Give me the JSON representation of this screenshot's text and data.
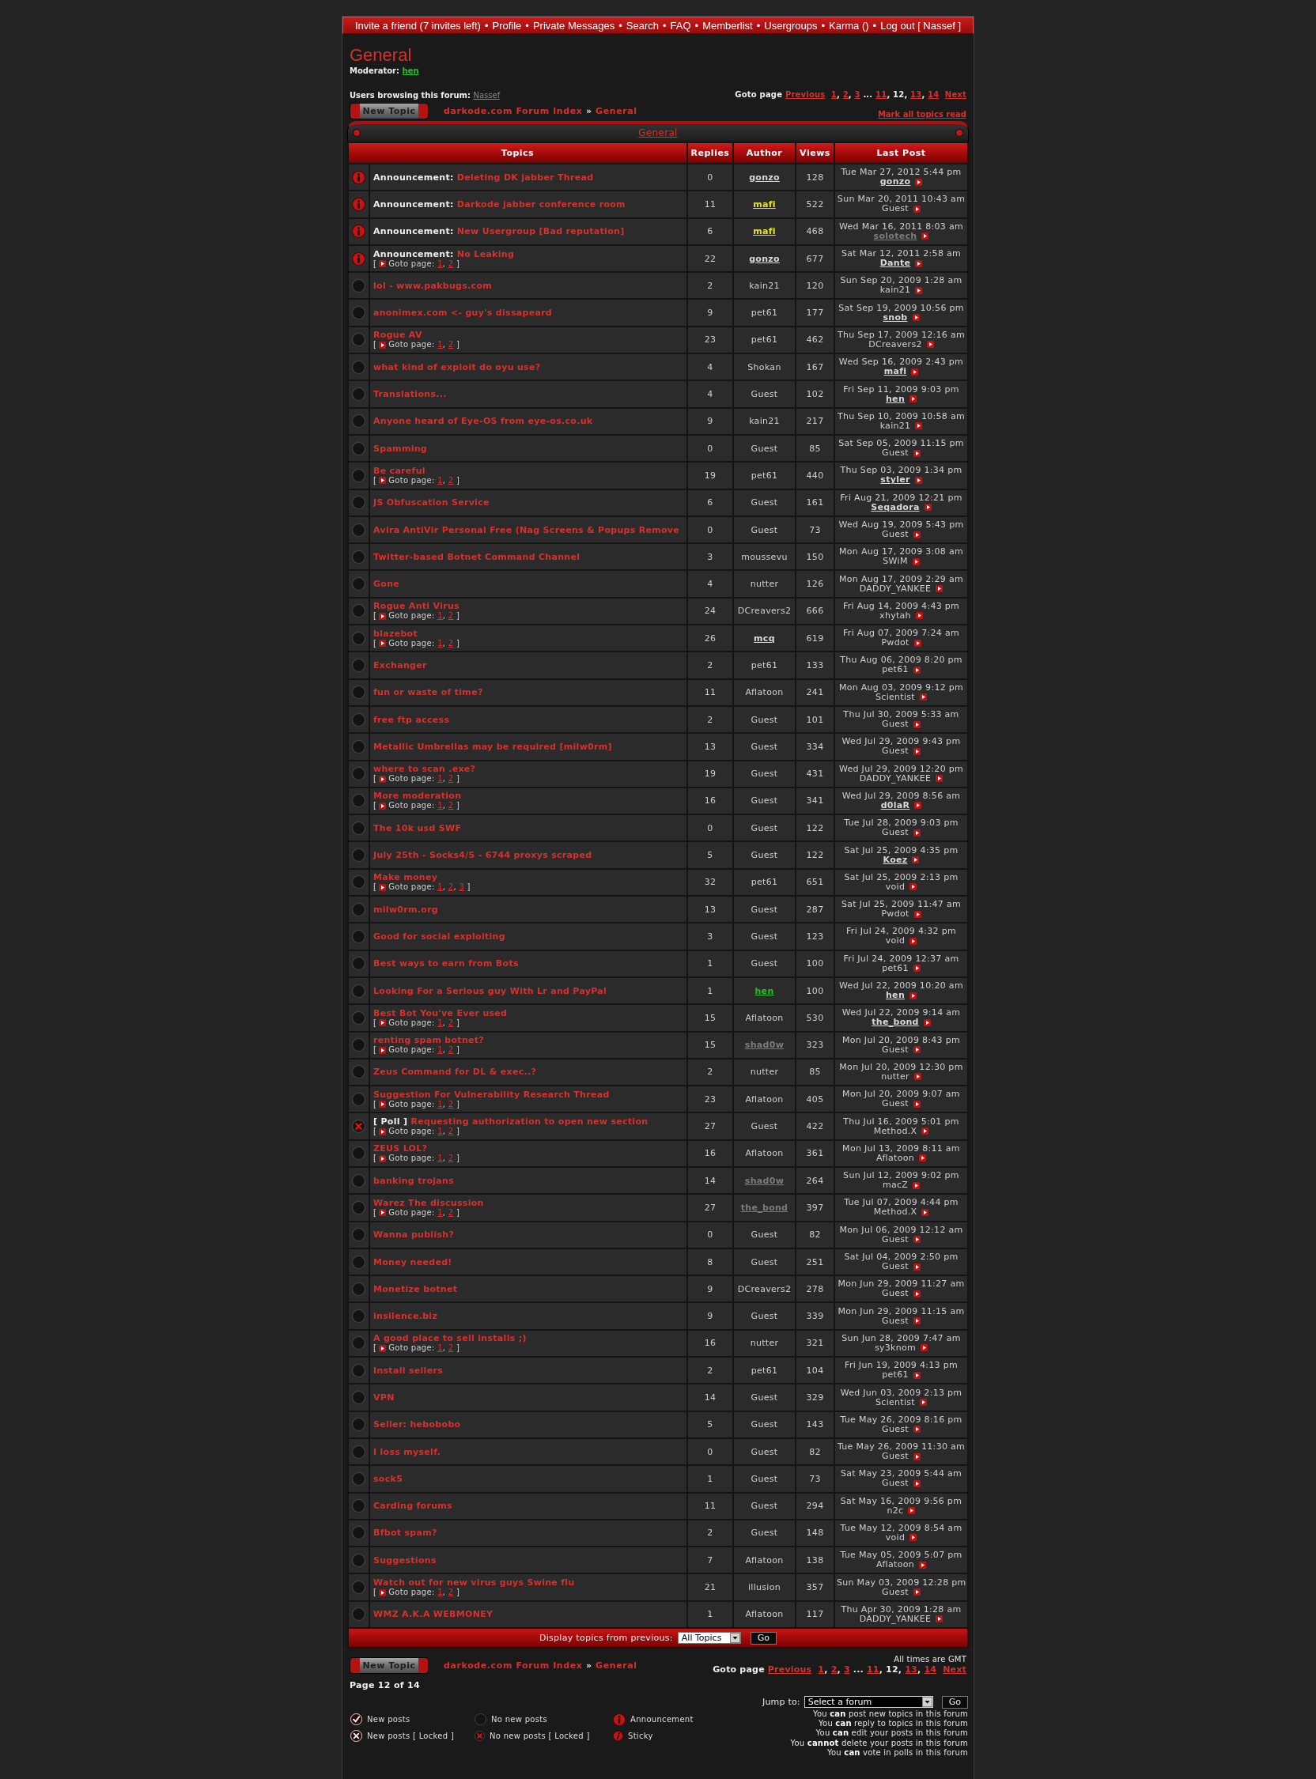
{
  "nav": {
    "links": [
      "Invite a friend (7 invites left)",
      "Profile",
      "Private Messages",
      "Search",
      "FAQ",
      "Memberlist",
      "Usergroups",
      "Karma ()",
      "Log out [ Nassef ]"
    ],
    "separator": "•"
  },
  "forum": {
    "title": "General",
    "moderator_label": "Moderator:",
    "moderator": "hen"
  },
  "browsing": {
    "label": "Users browsing this forum:",
    "user": "Nassef"
  },
  "top_pagination": {
    "label": "Goto page",
    "previous": "Previous",
    "pages": [
      {
        "kind": "page",
        "label": "1",
        "selected": false,
        "sep": ","
      },
      {
        "kind": "page",
        "label": "2",
        "selected": false,
        "sep": ","
      },
      {
        "kind": "page",
        "label": "3",
        "selected": false
      },
      {
        "kind": "gap",
        "label": "..."
      },
      {
        "kind": "page",
        "label": "11",
        "selected": false,
        "sep": ","
      },
      {
        "kind": "page",
        "label": "12",
        "selected": true,
        "sep": ","
      },
      {
        "kind": "page",
        "label": "13",
        "selected": false,
        "sep": ","
      },
      {
        "kind": "page",
        "label": "14",
        "selected": false
      }
    ],
    "next": "Next"
  },
  "top_actions": {
    "new_topic": "New Topic",
    "breadcrumb": {
      "items": [
        "darkode.com Forum Index",
        "General"
      ],
      "separator": "»"
    },
    "mark_read": "Mark all topics read"
  },
  "forum_bar": {
    "title": "General"
  },
  "table": {
    "columns": [
      "Topics",
      "Replies",
      "Author",
      "Views",
      "Last Post"
    ],
    "rows": [
      {
        "kind": "announcement",
        "prefix": "Announcement:",
        "title": "Deleting DK jabber Thread",
        "replies": "0",
        "author": {
          "name": "gonzo",
          "linked": true,
          "color": "#d8d8d8"
        },
        "views": "128",
        "last_post": {
          "date": "Tue Mar 27, 2012 5:44 pm",
          "user": {
            "name": "gonzo",
            "linked": true,
            "color": "#d8d8d8"
          }
        }
      },
      {
        "kind": "announcement",
        "prefix": "Announcement:",
        "title": "Darkode jabber conference room",
        "replies": "11",
        "author": {
          "name": "mafi",
          "linked": true,
          "color": "#e6e619"
        },
        "views": "522",
        "last_post": {
          "date": "Sun Mar 20, 2011 10:43 am",
          "user": {
            "name": "Guest",
            "linked": false
          }
        }
      },
      {
        "kind": "announcement",
        "prefix": "Announcement:",
        "title": "New Usergroup [Bad reputation]",
        "replies": "6",
        "author": {
          "name": "mafi",
          "linked": true,
          "color": "#e6e619"
        },
        "views": "468",
        "last_post": {
          "date": "Wed Mar 16, 2011 8:03 am",
          "user": {
            "name": "solotech",
            "linked": true,
            "color": "#7c7c7c"
          }
        }
      },
      {
        "kind": "announcement",
        "prefix": "Announcement:",
        "title": "No Leaking",
        "goto": {
          "open": "[",
          "label": "Goto page:",
          "pages": [
            "1",
            "2"
          ],
          "sep": ",",
          "close": "]"
        },
        "replies": "22",
        "author": {
          "name": "gonzo",
          "linked": true,
          "color": "#d8d8d8"
        },
        "views": "677",
        "last_post": {
          "date": "Sat Mar 12, 2011 2:58 am",
          "user": {
            "name": "Dante",
            "linked": true,
            "color": "#d8d8d8"
          }
        }
      },
      {
        "kind": "normal",
        "title": "lol - www.pakbugs.com",
        "replies": "2",
        "author": {
          "name": "kain21",
          "linked": false
        },
        "views": "120",
        "last_post": {
          "date": "Sun Sep 20, 2009 1:28 am",
          "user": {
            "name": "kain21",
            "linked": false
          }
        }
      },
      {
        "kind": "normal",
        "title": "anonimex.com <- guy's dissapeard",
        "replies": "9",
        "author": {
          "name": "pet61",
          "linked": false
        },
        "views": "177",
        "last_post": {
          "date": "Sat Sep 19, 2009 10:56 pm",
          "user": {
            "name": "snob",
            "linked": true,
            "color": "#d8d8d8"
          }
        }
      },
      {
        "kind": "normal",
        "title": "Rogue AV",
        "goto": {
          "open": "[",
          "label": "Goto page:",
          "pages": [
            "1",
            "2"
          ],
          "sep": ",",
          "close": "]"
        },
        "replies": "23",
        "author": {
          "name": "pet61",
          "linked": false
        },
        "views": "462",
        "last_post": {
          "date": "Thu Sep 17, 2009 12:16 am",
          "user": {
            "name": "DCreavers2",
            "linked": false
          }
        }
      },
      {
        "kind": "normal",
        "title": "what kind of exploit do oyu use?",
        "replies": "4",
        "author": {
          "name": "Shokan",
          "linked": false
        },
        "views": "167",
        "last_post": {
          "date": "Wed Sep 16, 2009 2:43 pm",
          "user": {
            "name": "mafi",
            "linked": true,
            "color": "#d8d8d8"
          }
        }
      },
      {
        "kind": "normal",
        "title": "Translations...",
        "replies": "4",
        "author": {
          "name": "Guest",
          "linked": false
        },
        "views": "102",
        "last_post": {
          "date": "Fri Sep 11, 2009 9:03 pm",
          "user": {
            "name": "hen",
            "linked": true,
            "color": "#d8d8d8"
          }
        }
      },
      {
        "kind": "normal",
        "title": "Anyone heard of Eye-OS from eye-os.co.uk",
        "replies": "9",
        "author": {
          "name": "kain21",
          "linked": false
        },
        "views": "217",
        "last_post": {
          "date": "Thu Sep 10, 2009 10:58 am",
          "user": {
            "name": "kain21",
            "linked": false
          }
        }
      },
      {
        "kind": "normal",
        "title": "Spamming",
        "replies": "0",
        "author": {
          "name": "Guest",
          "linked": false
        },
        "views": "85",
        "last_post": {
          "date": "Sat Sep 05, 2009 11:15 pm",
          "user": {
            "name": "Guest",
            "linked": false
          }
        }
      },
      {
        "kind": "normal",
        "title": "Be careful",
        "goto": {
          "open": "[",
          "label": "Goto page:",
          "pages": [
            "1",
            "2"
          ],
          "sep": ",",
          "close": "]"
        },
        "replies": "19",
        "author": {
          "name": "pet61",
          "linked": false
        },
        "views": "440",
        "last_post": {
          "date": "Thu Sep 03, 2009 1:34 pm",
          "user": {
            "name": "styler",
            "linked": true,
            "color": "#d8d8d8"
          }
        }
      },
      {
        "kind": "normal",
        "title": "JS Obfuscation Service",
        "replies": "6",
        "author": {
          "name": "Guest",
          "linked": false
        },
        "views": "161",
        "last_post": {
          "date": "Fri Aug 21, 2009 12:21 pm",
          "user": {
            "name": "Seqadora",
            "linked": true,
            "color": "#d8d8d8"
          }
        }
      },
      {
        "kind": "normal",
        "title": "Avira AntiVir Personal Free (Nag Screens & Popups Remove",
        "replies": "0",
        "author": {
          "name": "Guest",
          "linked": false
        },
        "views": "73",
        "last_post": {
          "date": "Wed Aug 19, 2009 5:43 pm",
          "user": {
            "name": "Guest",
            "linked": false
          }
        }
      },
      {
        "kind": "normal",
        "title": "Twitter-based Botnet Command Channel",
        "replies": "3",
        "author": {
          "name": "moussevu",
          "linked": false
        },
        "views": "150",
        "last_post": {
          "date": "Mon Aug 17, 2009 3:08 am",
          "user": {
            "name": "SWiM",
            "linked": false
          }
        }
      },
      {
        "kind": "normal",
        "title": "Gone",
        "replies": "4",
        "author": {
          "name": "nutter",
          "linked": false
        },
        "views": "126",
        "last_post": {
          "date": "Mon Aug 17, 2009 2:29 am",
          "user": {
            "name": "DADDY_YANKEE",
            "linked": false
          }
        }
      },
      {
        "kind": "normal",
        "title": "Rogue Anti Virus",
        "goto": {
          "open": "[",
          "label": "Goto page:",
          "pages": [
            "1",
            "2"
          ],
          "sep": ",",
          "close": "]"
        },
        "replies": "24",
        "author": {
          "name": "DCreavers2",
          "linked": false
        },
        "views": "666",
        "last_post": {
          "date": "Fri Aug 14, 2009 4:43 pm",
          "user": {
            "name": "xhytah",
            "linked": false
          }
        }
      },
      {
        "kind": "normal",
        "title": "blazebot",
        "goto": {
          "open": "[",
          "label": "Goto page:",
          "pages": [
            "1",
            "2"
          ],
          "sep": ",",
          "close": "]"
        },
        "replies": "26",
        "author": {
          "name": "mcq",
          "linked": true,
          "color": "#d8d8d8"
        },
        "views": "619",
        "last_post": {
          "date": "Fri Aug 07, 2009 7:24 am",
          "user": {
            "name": "Pwdot",
            "linked": false
          }
        }
      },
      {
        "kind": "normal",
        "title": "Exchanger",
        "replies": "2",
        "author": {
          "name": "pet61",
          "linked": false
        },
        "views": "133",
        "last_post": {
          "date": "Thu Aug 06, 2009 8:20 pm",
          "user": {
            "name": "pet61",
            "linked": false
          }
        }
      },
      {
        "kind": "normal",
        "title": "fun or waste of time?",
        "replies": "11",
        "author": {
          "name": "Aflatoon",
          "linked": false
        },
        "views": "241",
        "last_post": {
          "date": "Mon Aug 03, 2009 9:12 pm",
          "user": {
            "name": "Scientist",
            "linked": false
          }
        }
      },
      {
        "kind": "normal",
        "title": "free ftp access",
        "replies": "2",
        "author": {
          "name": "Guest",
          "linked": false
        },
        "views": "101",
        "last_post": {
          "date": "Thu Jul 30, 2009 5:33 am",
          "user": {
            "name": "Guest",
            "linked": false
          }
        }
      },
      {
        "kind": "normal",
        "title": "Metallic Umbrellas may be required [milw0rm]",
        "replies": "13",
        "author": {
          "name": "Guest",
          "linked": false
        },
        "views": "334",
        "last_post": {
          "date": "Wed Jul 29, 2009 9:43 pm",
          "user": {
            "name": "Guest",
            "linked": false
          }
        }
      },
      {
        "kind": "normal",
        "title": "where to scan .exe?",
        "goto": {
          "open": "[",
          "label": "Goto page:",
          "pages": [
            "1",
            "2"
          ],
          "sep": ",",
          "close": "]"
        },
        "replies": "19",
        "author": {
          "name": "Guest",
          "linked": false
        },
        "views": "431",
        "last_post": {
          "date": "Wed Jul 29, 2009 12:20 pm",
          "user": {
            "name": "DADDY_YANKEE",
            "linked": false
          }
        }
      },
      {
        "kind": "normal",
        "title": "More moderation",
        "goto": {
          "open": "[",
          "label": "Goto page:",
          "pages": [
            "1",
            "2"
          ],
          "sep": ",",
          "close": "]"
        },
        "replies": "16",
        "author": {
          "name": "Guest",
          "linked": false
        },
        "views": "341",
        "last_post": {
          "date": "Wed Jul 29, 2009 8:56 am",
          "user": {
            "name": "d0laR",
            "linked": true,
            "color": "#d8d8d8"
          }
        }
      },
      {
        "kind": "normal",
        "title": "The 10k usd SWF",
        "replies": "0",
        "author": {
          "name": "Guest",
          "linked": false
        },
        "views": "122",
        "last_post": {
          "date": "Tue Jul 28, 2009 9:03 pm",
          "user": {
            "name": "Guest",
            "linked": false
          }
        }
      },
      {
        "kind": "normal",
        "title": "July 25th - Socks4/5 - 6744 proxys scraped",
        "replies": "5",
        "author": {
          "name": "Guest",
          "linked": false
        },
        "views": "122",
        "last_post": {
          "date": "Sat Jul 25, 2009 4:35 pm",
          "user": {
            "name": "Koez",
            "linked": true,
            "color": "#d8d8d8"
          }
        }
      },
      {
        "kind": "normal",
        "title": "Make money",
        "goto": {
          "open": "[",
          "label": "Goto page:",
          "pages": [
            "1",
            "2",
            "3"
          ],
          "sep": ",",
          "close": "]"
        },
        "replies": "32",
        "author": {
          "name": "pet61",
          "linked": false
        },
        "views": "651",
        "last_post": {
          "date": "Sat Jul 25, 2009 2:13 pm",
          "user": {
            "name": "void",
            "linked": false
          }
        }
      },
      {
        "kind": "normal",
        "title": "milw0rm.org",
        "replies": "13",
        "author": {
          "name": "Guest",
          "linked": false
        },
        "views": "287",
        "last_post": {
          "date": "Sat Jul 25, 2009 11:47 am",
          "user": {
            "name": "Pwdot",
            "linked": false
          }
        }
      },
      {
        "kind": "normal",
        "title": "Good for social exploiting",
        "replies": "3",
        "author": {
          "name": "Guest",
          "linked": false
        },
        "views": "123",
        "last_post": {
          "date": "Fri Jul 24, 2009 4:32 pm",
          "user": {
            "name": "void",
            "linked": false
          }
        }
      },
      {
        "kind": "normal",
        "title": "Best ways to earn from Bots",
        "replies": "1",
        "author": {
          "name": "Guest",
          "linked": false
        },
        "views": "100",
        "last_post": {
          "date": "Fri Jul 24, 2009 12:37 am",
          "user": {
            "name": "pet61",
            "linked": false
          }
        }
      },
      {
        "kind": "normal",
        "title": "Looking For a Serious guy With Lr and PayPal",
        "replies": "1",
        "author": {
          "name": "hen",
          "linked": true,
          "color": "#22c422"
        },
        "views": "100",
        "last_post": {
          "date": "Wed Jul 22, 2009 10:20 am",
          "user": {
            "name": "hen",
            "linked": true,
            "color": "#d8d8d8"
          }
        }
      },
      {
        "kind": "normal",
        "title": "Best Bot You've Ever used",
        "goto": {
          "open": "[",
          "label": "Goto page:",
          "pages": [
            "1",
            "2"
          ],
          "sep": ",",
          "close": "]"
        },
        "replies": "15",
        "author": {
          "name": "Aflatoon",
          "linked": false
        },
        "views": "530",
        "last_post": {
          "date": "Wed Jul 22, 2009 9:14 am",
          "user": {
            "name": "the_bond",
            "linked": true,
            "color": "#d8d8d8"
          }
        }
      },
      {
        "kind": "normal",
        "title": "renting spam botnet?",
        "goto": {
          "open": "[",
          "label": "Goto page:",
          "pages": [
            "1",
            "2"
          ],
          "sep": ",",
          "close": "]"
        },
        "replies": "15",
        "author": {
          "name": "shad0w",
          "linked": true,
          "color": "#7c7c7c"
        },
        "views": "323",
        "last_post": {
          "date": "Mon Jul 20, 2009 8:43 pm",
          "user": {
            "name": "Guest",
            "linked": false
          }
        }
      },
      {
        "kind": "normal",
        "title": "Zeus Command for DL & exec..?",
        "replies": "2",
        "author": {
          "name": "nutter",
          "linked": false
        },
        "views": "85",
        "last_post": {
          "date": "Mon Jul 20, 2009 12:30 pm",
          "user": {
            "name": "nutter",
            "linked": false
          }
        }
      },
      {
        "kind": "normal",
        "title": "Suggestion For Vulnerability Research Thread",
        "goto": {
          "open": "[",
          "label": "Goto page:",
          "pages": [
            "1",
            "2"
          ],
          "sep": ",",
          "close": "]"
        },
        "replies": "23",
        "author": {
          "name": "Aflatoon",
          "linked": false
        },
        "views": "405",
        "last_post": {
          "date": "Mon Jul 20, 2009 9:07 am",
          "user": {
            "name": "Guest",
            "linked": false
          }
        }
      },
      {
        "kind": "locked",
        "prefix": "[ Poll ]",
        "title": "Requesting authorization to open new section",
        "goto": {
          "open": "[",
          "label": "Goto page:",
          "pages": [
            "1",
            "2"
          ],
          "sep": ",",
          "close": "]"
        },
        "replies": "27",
        "author": {
          "name": "Guest",
          "linked": false
        },
        "views": "422",
        "last_post": {
          "date": "Thu Jul 16, 2009 5:01 pm",
          "user": {
            "name": "Method.X",
            "linked": false
          }
        }
      },
      {
        "kind": "normal",
        "title": "ZEUS LOL?",
        "goto": {
          "open": "[",
          "label": "Goto page:",
          "pages": [
            "1",
            "2"
          ],
          "sep": ",",
          "close": "]"
        },
        "replies": "16",
        "author": {
          "name": "Aflatoon",
          "linked": false
        },
        "views": "361",
        "last_post": {
          "date": "Mon Jul 13, 2009 8:11 am",
          "user": {
            "name": "Aflatoon",
            "linked": false
          }
        }
      },
      {
        "kind": "normal",
        "title": "banking trojans",
        "replies": "14",
        "author": {
          "name": "shad0w",
          "linked": true,
          "color": "#7c7c7c"
        },
        "views": "264",
        "last_post": {
          "date": "Sun Jul 12, 2009 9:02 pm",
          "user": {
            "name": "macZ",
            "linked": false
          }
        }
      },
      {
        "kind": "normal",
        "title": "Warez The discussion",
        "goto": {
          "open": "[",
          "label": "Goto page:",
          "pages": [
            "1",
            "2"
          ],
          "sep": ",",
          "close": "]"
        },
        "replies": "27",
        "author": {
          "name": "the_bond",
          "linked": true,
          "color": "#7c7c7c"
        },
        "views": "397",
        "last_post": {
          "date": "Tue Jul 07, 2009 4:44 pm",
          "user": {
            "name": "Method.X",
            "linked": false
          }
        }
      },
      {
        "kind": "normal",
        "title": "Wanna publish?",
        "replies": "0",
        "author": {
          "name": "Guest",
          "linked": false
        },
        "views": "82",
        "last_post": {
          "date": "Mon Jul 06, 2009 12:12 am",
          "user": {
            "name": "Guest",
            "linked": false
          }
        }
      },
      {
        "kind": "normal",
        "title": "Money needed!",
        "replies": "8",
        "author": {
          "name": "Guest",
          "linked": false
        },
        "views": "251",
        "last_post": {
          "date": "Sat Jul 04, 2009 2:50 pm",
          "user": {
            "name": "Guest",
            "linked": false
          }
        }
      },
      {
        "kind": "normal",
        "title": "Monetize botnet",
        "replies": "9",
        "author": {
          "name": "DCreavers2",
          "linked": false
        },
        "views": "278",
        "last_post": {
          "date": "Mon Jun 29, 2009 11:27 am",
          "user": {
            "name": "Guest",
            "linked": false
          }
        }
      },
      {
        "kind": "normal",
        "title": "insilence.biz",
        "replies": "9",
        "author": {
          "name": "Guest",
          "linked": false
        },
        "views": "339",
        "last_post": {
          "date": "Mon Jun 29, 2009 11:15 am",
          "user": {
            "name": "Guest",
            "linked": false
          }
        }
      },
      {
        "kind": "normal",
        "title": "A good place to sell installs ;)",
        "goto": {
          "open": "[",
          "label": "Goto page:",
          "pages": [
            "1",
            "2"
          ],
          "sep": ",",
          "close": "]"
        },
        "replies": "16",
        "author": {
          "name": "nutter",
          "linked": false
        },
        "views": "321",
        "last_post": {
          "date": "Sun Jun 28, 2009 7:47 am",
          "user": {
            "name": "sy3knom",
            "linked": false
          }
        }
      },
      {
        "kind": "normal",
        "title": "Install sellers",
        "replies": "2",
        "author": {
          "name": "pet61",
          "linked": false
        },
        "views": "104",
        "last_post": {
          "date": "Fri Jun 19, 2009 4:13 pm",
          "user": {
            "name": "pet61",
            "linked": false
          }
        }
      },
      {
        "kind": "normal",
        "title": "VPN",
        "replies": "14",
        "author": {
          "name": "Guest",
          "linked": false
        },
        "views": "329",
        "last_post": {
          "date": "Wed Jun 03, 2009 2:13 pm",
          "user": {
            "name": "Scientist",
            "linked": false
          }
        }
      },
      {
        "kind": "normal",
        "title": "Seller: hebobobo",
        "replies": "5",
        "author": {
          "name": "Guest",
          "linked": false
        },
        "views": "143",
        "last_post": {
          "date": "Tue May 26, 2009 8:16 pm",
          "user": {
            "name": "Guest",
            "linked": false
          }
        }
      },
      {
        "kind": "normal",
        "title": "I loss myself.",
        "replies": "0",
        "author": {
          "name": "Guest",
          "linked": false
        },
        "views": "82",
        "last_post": {
          "date": "Tue May 26, 2009 11:30 am",
          "user": {
            "name": "Guest",
            "linked": false
          }
        }
      },
      {
        "kind": "normal",
        "title": "sock5",
        "replies": "1",
        "author": {
          "name": "Guest",
          "linked": false
        },
        "views": "73",
        "last_post": {
          "date": "Sat May 23, 2009 5:44 am",
          "user": {
            "name": "Guest",
            "linked": false
          }
        }
      },
      {
        "kind": "normal",
        "title": "Carding forums",
        "replies": "11",
        "author": {
          "name": "Guest",
          "linked": false
        },
        "views": "294",
        "last_post": {
          "date": "Sat May 16, 2009 9:56 pm",
          "user": {
            "name": "n2c",
            "linked": false
          }
        }
      },
      {
        "kind": "normal",
        "title": "Bfbot spam?",
        "replies": "2",
        "author": {
          "name": "Guest",
          "linked": false
        },
        "views": "148",
        "last_post": {
          "date": "Tue May 12, 2009 8:54 am",
          "user": {
            "name": "void",
            "linked": false
          }
        }
      },
      {
        "kind": "normal",
        "title": "Suggestions",
        "replies": "7",
        "author": {
          "name": "Aflatoon",
          "linked": false
        },
        "views": "138",
        "last_post": {
          "date": "Tue May 05, 2009 5:07 pm",
          "user": {
            "name": "Aflatoon",
            "linked": false
          }
        }
      },
      {
        "kind": "normal",
        "title": "Watch out for new virus guys Swine flu",
        "goto": {
          "open": "[",
          "label": "Goto page:",
          "pages": [
            "1",
            "2"
          ],
          "sep": ",",
          "close": "]"
        },
        "replies": "21",
        "author": {
          "name": "illusion",
          "linked": false
        },
        "views": "357",
        "last_post": {
          "date": "Sun May 03, 2009 12:28 pm",
          "user": {
            "name": "Guest",
            "linked": false
          }
        }
      },
      {
        "kind": "normal",
        "title": "WMZ A.K.A WEBMONEY",
        "replies": "1",
        "author": {
          "name": "Aflatoon",
          "linked": false
        },
        "views": "117",
        "last_post": {
          "date": "Thu Apr 30, 2009 1:28 am",
          "user": {
            "name": "DADDY_YANKEE",
            "linked": false
          }
        }
      }
    ],
    "display": {
      "label": "Display topics from previous:",
      "value": "All Topics",
      "button": "Go"
    }
  },
  "bottom_actions": {
    "new_topic": "New Topic",
    "breadcrumb": {
      "items": [
        "darkode.com Forum Index",
        "General"
      ],
      "separator": "»"
    },
    "timezone": "All times are GMT"
  },
  "bottom_pagination": {
    "label": "Goto page",
    "previous": "Previous",
    "pages": [
      {
        "kind": "page",
        "label": "1",
        "selected": false,
        "sep": ","
      },
      {
        "kind": "page",
        "label": "2",
        "selected": false,
        "sep": ","
      },
      {
        "kind": "page",
        "label": "3",
        "selected": false
      },
      {
        "kind": "gap",
        "label": "..."
      },
      {
        "kind": "page",
        "label": "11",
        "selected": false,
        "sep": ","
      },
      {
        "kind": "page",
        "label": "12",
        "selected": true,
        "sep": ","
      },
      {
        "kind": "page",
        "label": "13",
        "selected": false,
        "sep": ","
      },
      {
        "kind": "page",
        "label": "14",
        "selected": false
      }
    ],
    "next": "Next"
  },
  "page_count": "Page 12 of 14",
  "jump": {
    "label": "Jump to:",
    "value": "Select a forum",
    "button": "Go"
  },
  "legend": [
    {
      "kind": "new",
      "label": "New posts"
    },
    {
      "kind": "none",
      "label": "No new posts"
    },
    {
      "kind": "announcement",
      "label": "Announcement"
    },
    {
      "kind": "new_locked",
      "label": "New posts [ Locked ]"
    },
    {
      "kind": "locked",
      "label": "No new posts [ Locked ]"
    },
    {
      "kind": "sticky",
      "label": "Sticky"
    }
  ],
  "permissions": [
    "You **can** post new topics in this forum",
    "You **can** reply to topics in this forum",
    "You **can** edit your posts in this forum",
    "You **cannot** delete your posts in this forum",
    "You **can** vote in polls in this forum"
  ]
}
